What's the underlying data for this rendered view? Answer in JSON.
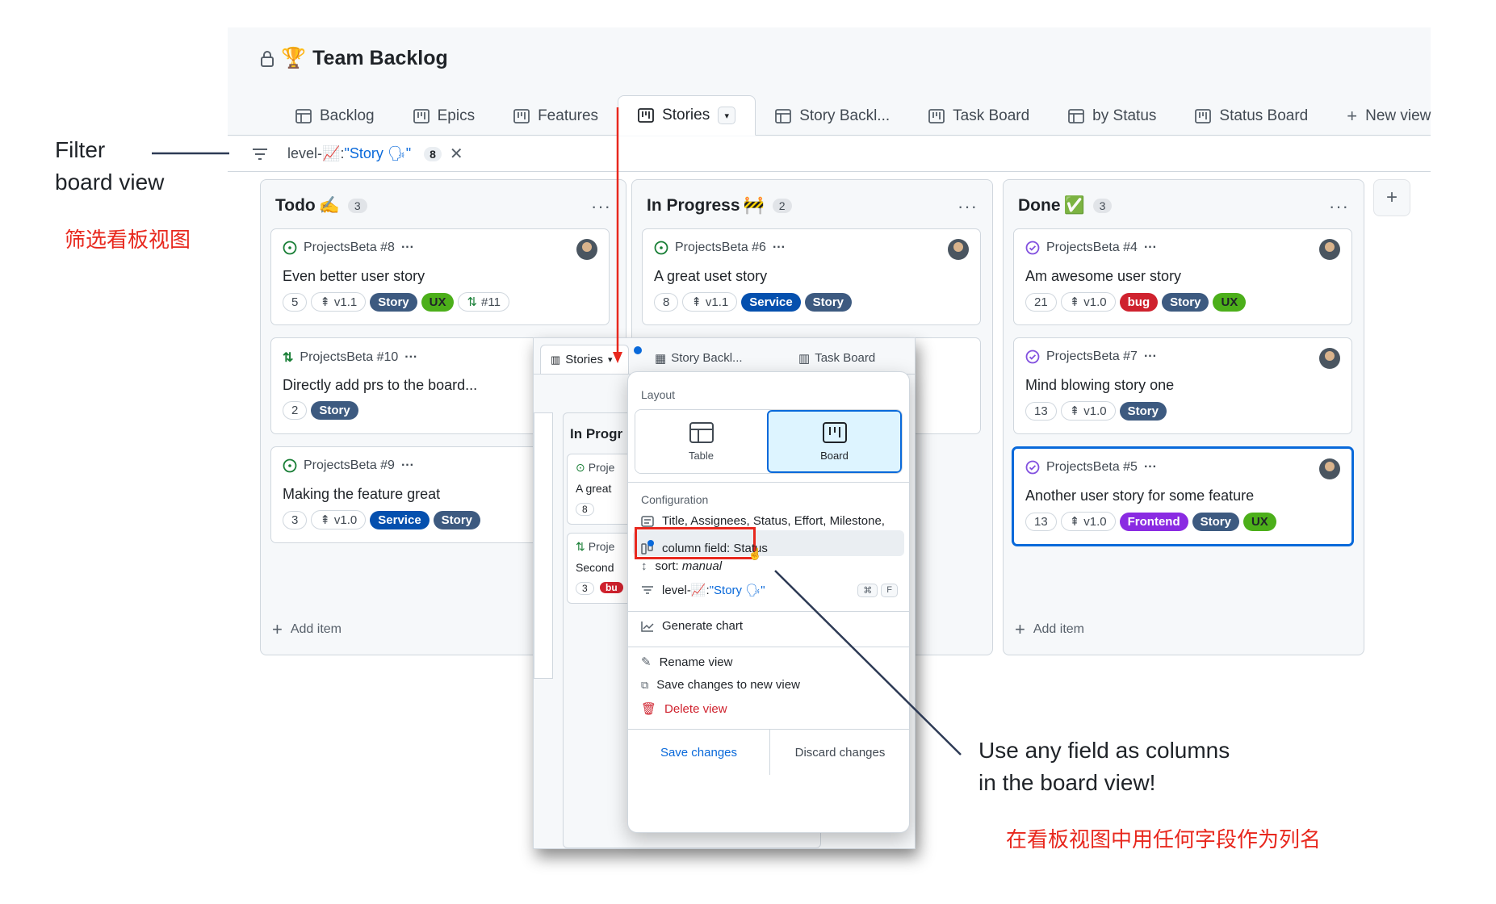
{
  "project": {
    "title": "Team Backlog",
    "emoji": "🏆"
  },
  "tabs": [
    {
      "label": "Backlog",
      "icon": "table-icon"
    },
    {
      "label": "Epics",
      "icon": "board-icon"
    },
    {
      "label": "Features",
      "icon": "board-icon"
    },
    {
      "label": "Stories",
      "icon": "board-icon",
      "active": true
    },
    {
      "label": "Story Backl...",
      "icon": "table-icon"
    },
    {
      "label": "Task Board",
      "icon": "board-icon"
    },
    {
      "label": "by Status",
      "icon": "table-icon"
    },
    {
      "label": "Status Board",
      "icon": "board-icon"
    },
    {
      "label": "New view",
      "icon": "plus-icon"
    }
  ],
  "filter": {
    "prefix": "level-",
    "emoji": "📈",
    "colon": ":",
    "value": "\"Story 🗣\"",
    "count": "8"
  },
  "columns": [
    {
      "name": "Todo",
      "emoji": "✍",
      "count": "3",
      "add_item": "Add item",
      "cards": [
        {
          "ref": "ProjectsBeta #8",
          "title": "Even better user story",
          "status": "open",
          "effort": "5",
          "milestone": "v1.1",
          "labels": [
            {
              "text": "Story",
              "color": "#3d5a80"
            },
            {
              "text": "UX",
              "color": "#4caf1a"
            }
          ],
          "pr": "#11"
        },
        {
          "ref": "ProjectsBeta #10",
          "title": "Directly add prs to the board...",
          "status": "pr",
          "effort": "2",
          "labels": [
            {
              "text": "Story",
              "color": "#3d5a80"
            }
          ]
        },
        {
          "ref": "ProjectsBeta #9",
          "title": "Making the feature great",
          "status": "open",
          "effort": "3",
          "milestone": "v1.0",
          "labels": [
            {
              "text": "Service",
              "color": "#0550ae"
            },
            {
              "text": "Story",
              "color": "#3d5a80"
            }
          ]
        }
      ]
    },
    {
      "name": "In Progress",
      "emoji": "🚧",
      "count": "2",
      "cards": [
        {
          "ref": "ProjectsBeta #6",
          "title": "A great uset story",
          "status": "open",
          "effort": "8",
          "milestone": "v1.1",
          "labels": [
            {
              "text": "Service",
              "color": "#0550ae"
            },
            {
              "text": "Story",
              "color": "#3d5a80"
            }
          ]
        }
      ]
    },
    {
      "name": "Done",
      "emoji": "✅",
      "count": "3",
      "add_item": "Add item",
      "cards": [
        {
          "ref": "ProjectsBeta #4",
          "title": "Am awesome user story",
          "status": "closed",
          "effort": "21",
          "milestone": "v1.0",
          "labels": [
            {
              "text": "bug",
              "color": "#cf222e"
            },
            {
              "text": "Story",
              "color": "#3d5a80"
            },
            {
              "text": "UX",
              "color": "#4caf1a"
            }
          ]
        },
        {
          "ref": "ProjectsBeta #7",
          "title": "Mind blowing story one",
          "status": "closed",
          "effort": "13",
          "milestone": "v1.0",
          "labels": [
            {
              "text": "Story",
              "color": "#3d5a80"
            }
          ]
        },
        {
          "ref": "ProjectsBeta #5",
          "title": "Another user story for some feature",
          "status": "closed",
          "effort": "13",
          "milestone": "v1.0",
          "labels": [
            {
              "text": "Frontend",
              "color": "#8a2be2"
            },
            {
              "text": "Story",
              "color": "#3d5a80"
            },
            {
              "text": "UX",
              "color": "#4caf1a"
            }
          ]
        }
      ]
    }
  ],
  "overlay": {
    "tabs": [
      "Stories",
      "Story Backl...",
      "Task Board"
    ],
    "column_title": "In Progr",
    "card1_ref": "Proje",
    "card1_title": "A great",
    "card1_effort": "8",
    "card2_ref": "Proje",
    "card2_title": "Second",
    "card2_effort": "3",
    "card2_label": "bu"
  },
  "menu": {
    "layout_title": "Layout",
    "layout_table": "Table",
    "layout_board": "Board",
    "config_title": "Configuration",
    "fields": "Title, Assignees, Status, Effort, Milestone,",
    "column_field_prefix": "column field: ",
    "column_field_value": "Status",
    "sort_prefix": "sort: ",
    "sort_value": "manual",
    "filter_prefix": "level-",
    "filter_value": "\"Story 🗣\"",
    "kbd1": "⌘",
    "kbd2": "F",
    "generate_chart": "Generate chart",
    "rename_view": "Rename view",
    "save_new": "Save changes to new view",
    "delete_view": "Delete view",
    "save_changes": "Save changes",
    "discard_changes": "Discard changes"
  },
  "annotations": {
    "filter_en_line1": "Filter",
    "filter_en_line2": "board view",
    "filter_zh": "筛选看板视图",
    "columns_en_line1": "Use any field as columns",
    "columns_en_line2": "in the board view!",
    "columns_zh": "在看板视图中用任何字段作为列名"
  },
  "colors": {
    "annotation_red": "#e8281e",
    "accent_blue": "#0969da"
  }
}
